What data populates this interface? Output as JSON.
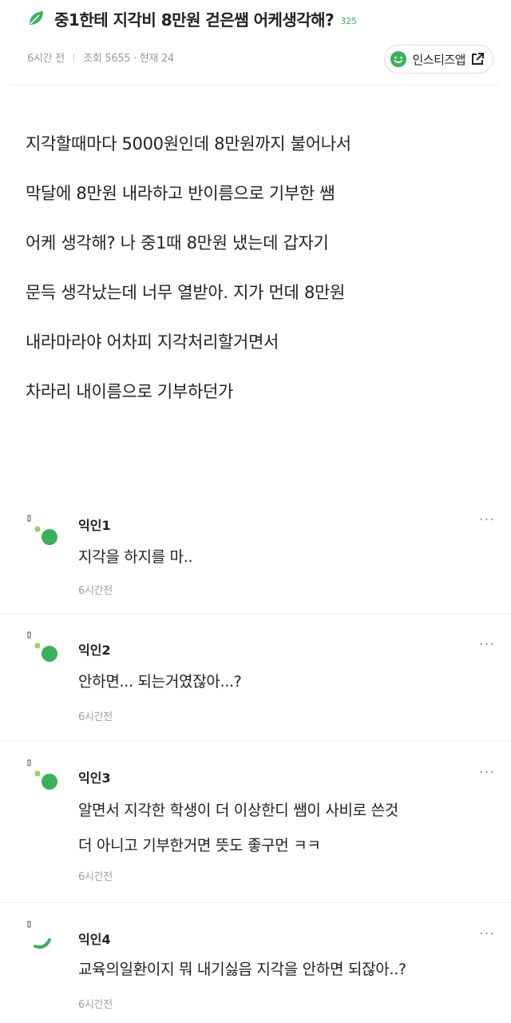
{
  "post": {
    "title": "중1한테 지각비 8만원 걷은쌤 어케생각해?",
    "title_count": "325",
    "time": "6시간 전",
    "separator": "|",
    "views": "조회 5655 · 현재 24",
    "app_button_label": "인스티즈앱",
    "body_lines": [
      "지각할때마다 5000원인데 8만원까지 불어나서",
      "막달에 8만원 내라하고 반이름으로 기부한 쌤",
      "어케 생각해? 나 중1때 8만원 냈는데 갑자기",
      "문득 생각났는데 너무 열받아. 지가 먼데 8만원",
      "내라마라야 어차피 지각처리할거면서",
      "차라리 내이름으로 기부하던가"
    ]
  },
  "comments": [
    {
      "name": "익인1",
      "lines": [
        "지각을 하지를 마.."
      ],
      "time": "6시간전",
      "more": "···"
    },
    {
      "name": "익인2",
      "lines": [
        "안하면... 되는거였잖아...?"
      ],
      "time": "6시간전",
      "more": "···"
    },
    {
      "name": "익인3",
      "lines": [
        "알면서 지각한 학생이 더 이상한디 쌤이 사비로 쓴것",
        "더 아니고 기부한거면 뜻도 좋구먼 ㅋㅋ"
      ],
      "time": "6시간전",
      "more": "···"
    },
    {
      "name": "익인4",
      "lines": [
        "교육의일환이지 뭐 내기싫음 지각을 안하면 되잖아..?"
      ],
      "time": "6시간전",
      "more": "···"
    }
  ],
  "icons": {
    "title_icon": "leaf-icon",
    "app_icon": "smile-icon",
    "external_icon": "external-link-icon",
    "avatar_icon": "avatar-dots-icon"
  },
  "colors": {
    "brand_green": "#3bb05a",
    "light_green": "#8fd65a",
    "meta_gray": "#9a9a9a"
  }
}
